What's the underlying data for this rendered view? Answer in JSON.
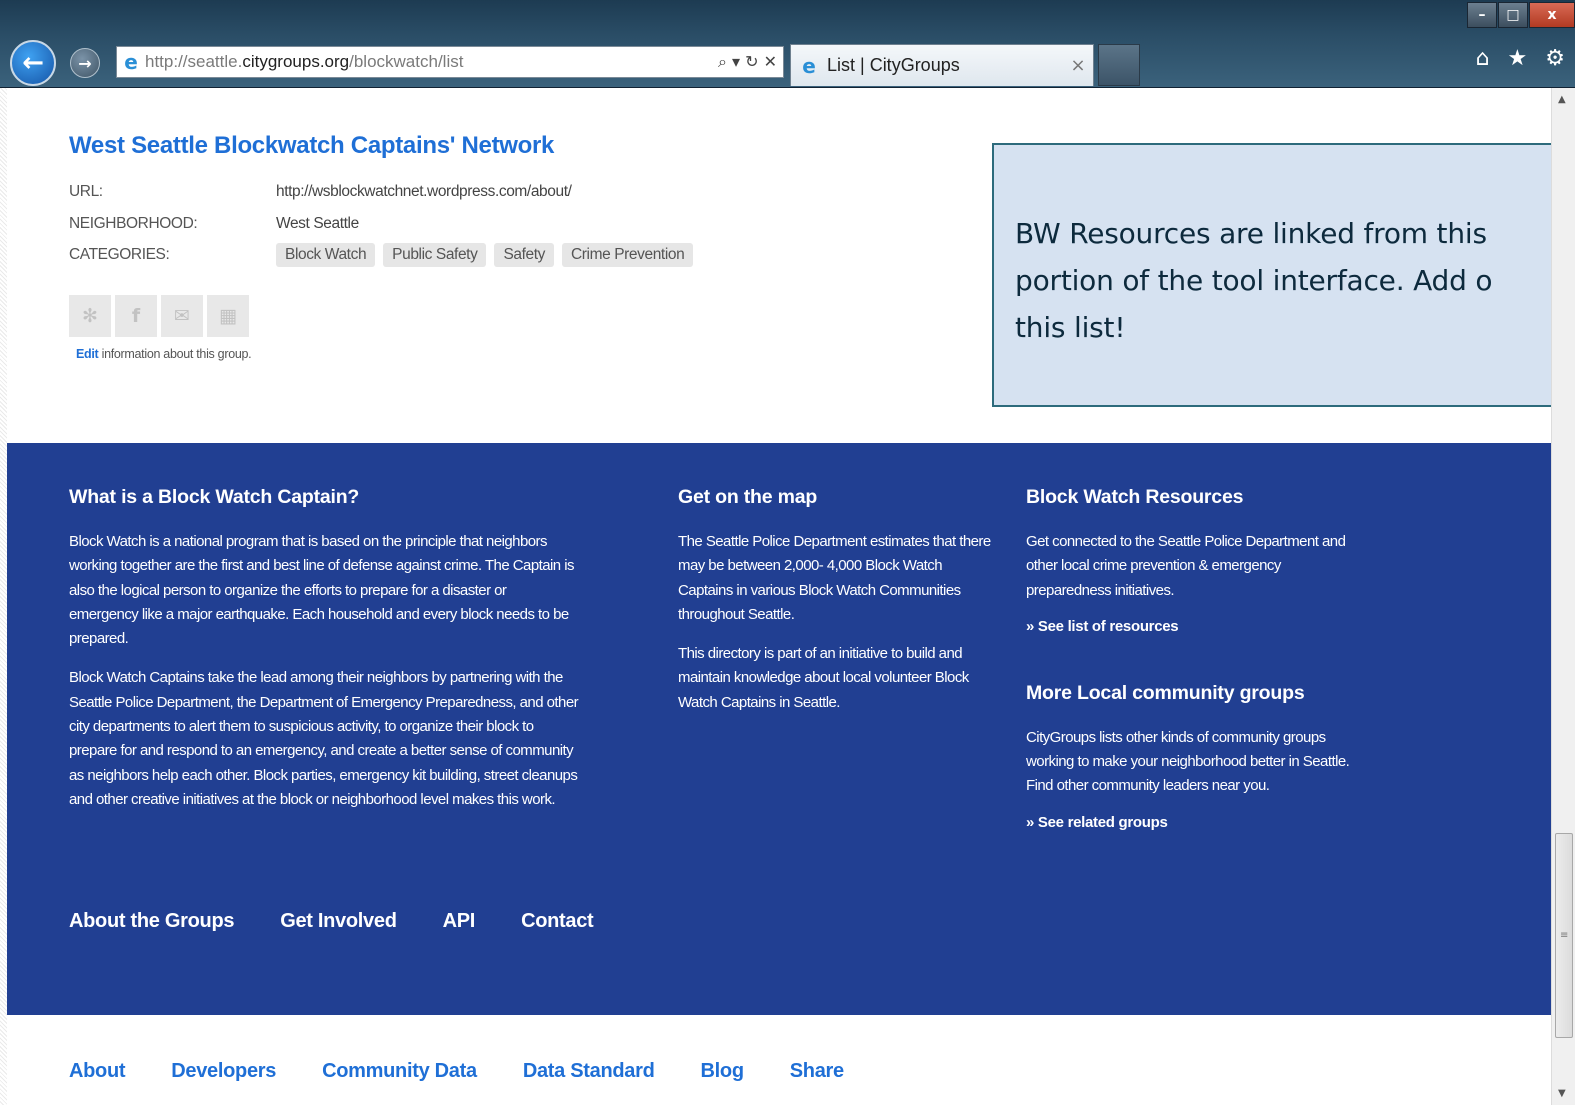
{
  "browser": {
    "back_icon": "back-arrow-icon",
    "forward_icon": "forward-arrow-icon",
    "url_prefix": "http://seattle.",
    "url_domain": "citygroups.org",
    "url_path": "/blockwatch/list",
    "address_tools": "⌕ ▾ ↻ ✕",
    "tab_title": "List | CityGroups",
    "tab_close": "×",
    "window_buttons": [
      "–",
      "□",
      "x"
    ],
    "toolbar_icons": [
      "⌂",
      "★",
      "⚙"
    ]
  },
  "group": {
    "title": "West Seattle Blockwatch Captains' Network",
    "url_label": "URL:",
    "url_value": "http://wsblockwatchnet.wordpress.com/about/",
    "neighborhood_label": "NEIGHBORHOOD:",
    "neighborhood_value": "West Seattle",
    "categories_label": "CATEGORIES:",
    "categories": [
      "Block Watch",
      "Public Safety",
      "Safety",
      "Crime Prevention"
    ],
    "share_icons": [
      "twitter-icon",
      "facebook-icon",
      "email-icon",
      "qr-code-icon"
    ],
    "edit_link": "Edit",
    "edit_text": " information about this group."
  },
  "callout": {
    "line1": "BW Resources are linked from this",
    "line2": "portion of the tool interface. Add o",
    "line3": "this list!"
  },
  "footer": {
    "col1": {
      "heading": "What is a Block Watch Captain?",
      "p1": "Block Watch is a national program that is based on the principle that neighbors working together are the first and best line of defense against crime. The Captain is also the logical person to organize the efforts to prepare for a disaster or emergency like a major earthquake. Each household and every block needs to be prepared.",
      "p2": "Block Watch Captains take the lead among their neighbors by partnering with the Seattle Police Department, the Department of Emergency Preparedness, and other city departments to alert them to suspicious activity, to organize their block to prepare for and respond to an emergency, and create a better sense of community as neighbors help each other. Block parties, emergency kit building, street cleanups and other creative initiatives at the block or neighborhood level makes this work."
    },
    "col2": {
      "heading": "Get on the map",
      "p1": "The Seattle Police Department estimates that there may be between 2,000- 4,000 Block Watch Captains in various Block Watch Communities throughout Seattle.",
      "p2": "This directory is part of an initiative to build and maintain knowledge about local volunteer Block Watch Captains in Seattle."
    },
    "col3": {
      "heading1": "Block Watch Resources",
      "p1": "Get connected to the Seattle Police Department and other local crime prevention & emergency preparedness initiatives.",
      "link1": "» See list of resources",
      "heading2": "More Local community groups",
      "p2": "CityGroups lists other kinds of community groups working to make your neighborhood better in Seattle. Find other community leaders near you.",
      "link2": "» See related groups"
    },
    "nav": [
      "About the Groups",
      "Get Involved",
      "API",
      "Contact"
    ]
  },
  "bottom_nav": [
    "About",
    "Developers",
    "Community Data",
    "Data Standard",
    "Blog",
    "Share"
  ]
}
